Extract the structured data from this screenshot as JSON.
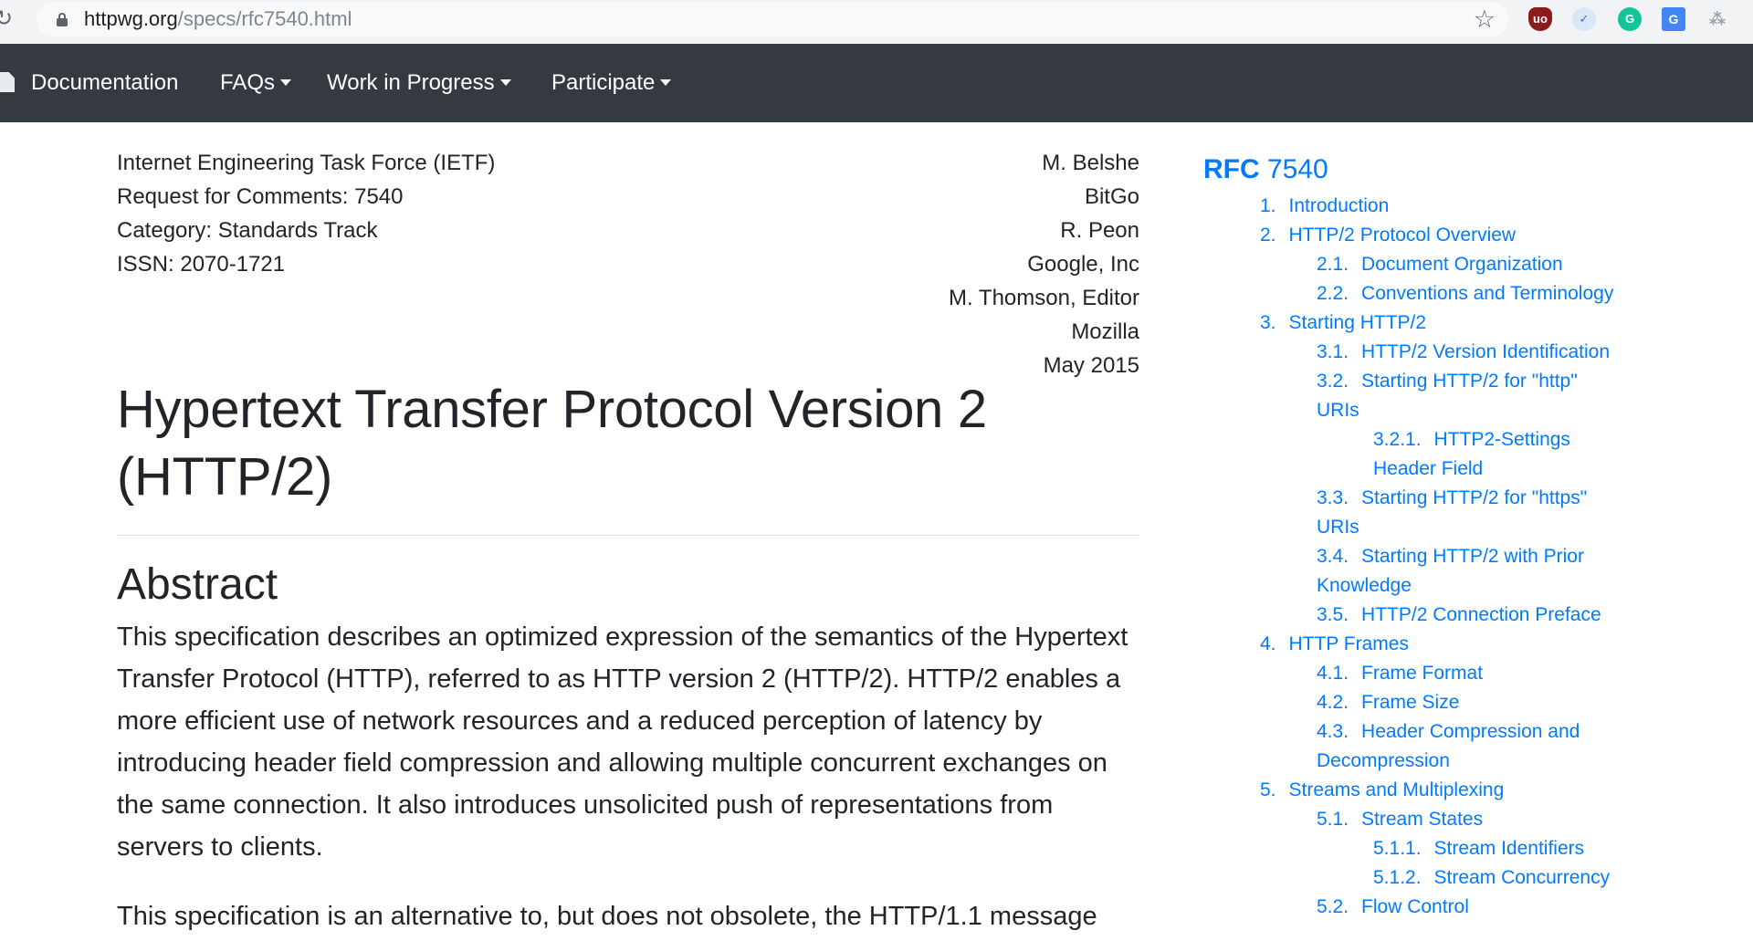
{
  "browser": {
    "reload_icon": "↻",
    "url_host": "httpwg.org",
    "url_path": "/specs/rfc7540.html",
    "star_icon": "☆",
    "extensions": {
      "ublock": "uo",
      "feedly": "✓",
      "grammarly": "G",
      "translate": "G",
      "tree": "⁂"
    }
  },
  "navbar": {
    "documentation": "Documentation",
    "faqs": "FAQs",
    "work_in_progress": "Work in Progress",
    "participate": "Participate"
  },
  "doc": {
    "meta_left": [
      "Internet Engineering Task Force (IETF)",
      "Request for Comments: 7540",
      "Category: Standards Track",
      "ISSN: 2070-1721"
    ],
    "meta_right": [
      "M. Belshe",
      "BitGo",
      "R. Peon",
      "Google, Inc",
      "M. Thomson, Editor",
      "Mozilla",
      "May 2015"
    ],
    "title": "Hypertext Transfer Protocol Version 2 (HTTP/2)",
    "abstract_heading": "Abstract",
    "abstract_p1": "This specification describes an optimized expression of the semantics of the Hypertext Transfer Protocol (HTTP), referred to as HTTP version 2 (HTTP/2). HTTP/2 enables a more efficient use of network resources and a reduced perception of latency by introducing header field compression and allowing multiple concurrent exchanges on the same connection. It also introduces unsolicited push of representations from servers to clients.",
    "abstract_p2": "This specification is an alternative to, but does not obsolete, the HTTP/1.1 message"
  },
  "toc": {
    "title_rfc": "RFC",
    "title_num": "7540",
    "items": [
      {
        "num": "1.",
        "label": "Introduction"
      },
      {
        "num": "2.",
        "label": "HTTP/2 Protocol Overview"
      },
      {
        "num": "2.1.",
        "label": "Document Organization"
      },
      {
        "num": "2.2.",
        "label": "Conventions and Terminology"
      },
      {
        "num": "3.",
        "label": "Starting HTTP/2"
      },
      {
        "num": "3.1.",
        "label": "HTTP/2 Version Identification"
      },
      {
        "num": "3.2.",
        "label": "Starting HTTP/2 for \"http\" URIs"
      },
      {
        "num": "3.2.1.",
        "label": "HTTP2-Settings Header Field"
      },
      {
        "num": "3.3.",
        "label": "Starting HTTP/2 for \"https\" URIs"
      },
      {
        "num": "3.4.",
        "label": "Starting HTTP/2 with Prior Knowledge"
      },
      {
        "num": "3.5.",
        "label": "HTTP/2 Connection Preface"
      },
      {
        "num": "4.",
        "label": "HTTP Frames"
      },
      {
        "num": "4.1.",
        "label": "Frame Format"
      },
      {
        "num": "4.2.",
        "label": "Frame Size"
      },
      {
        "num": "4.3.",
        "label": "Header Compression and Decompression"
      },
      {
        "num": "5.",
        "label": "Streams and Multiplexing"
      },
      {
        "num": "5.1.",
        "label": "Stream States"
      },
      {
        "num": "5.1.1.",
        "label": "Stream Identifiers"
      },
      {
        "num": "5.1.2.",
        "label": "Stream Concurrency"
      },
      {
        "num": "5.2.",
        "label": "Flow Control"
      }
    ]
  }
}
